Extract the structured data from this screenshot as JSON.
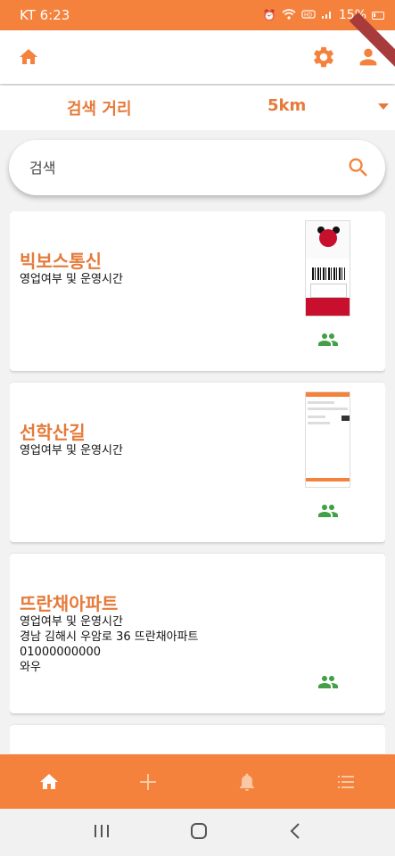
{
  "status_bar": {
    "carrier_time": "KT 6:23",
    "battery": "15%",
    "icons": [
      "alarm-icon",
      "wifi-icon",
      "volte-icon",
      "signal-icon",
      "battery-icon"
    ]
  },
  "app_bar": {
    "icons": [
      "home-icon",
      "settings-icon",
      "profile-icon"
    ],
    "accent_color": "#f5823c"
  },
  "distance": {
    "label": "검색 거리",
    "value": "5km"
  },
  "search": {
    "placeholder": "검색"
  },
  "stores": [
    {
      "name": "빅보스통신",
      "lines": [
        "영업여부 및 운영시간"
      ],
      "has_thumbnail": true,
      "thumbnail": "receipt-image"
    },
    {
      "name": "선학산길",
      "lines": [
        "영업여부 및 운영시간"
      ],
      "has_thumbnail": true,
      "thumbnail": "app-screenshot-image"
    },
    {
      "name": "뜨란채아파트",
      "lines": [
        "영업여부 및 운영시간",
        "경남 김해시 우암로 36 뜨란채아파트",
        "01000000000",
        "와우"
      ],
      "has_thumbnail": false
    }
  ],
  "bottom_nav": {
    "items": [
      "home-icon",
      "add-icon",
      "notifications-icon",
      "list-icon"
    ]
  },
  "colors": {
    "primary": "#f5823c",
    "title_text": "#e57a3a",
    "people_icon": "#43a047"
  }
}
